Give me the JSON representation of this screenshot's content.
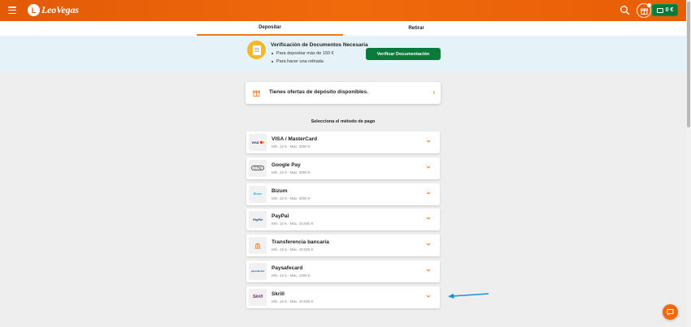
{
  "header": {
    "brand": "LeoVegas",
    "balance": "0 €",
    "icons": [
      "menu-icon",
      "search-icon",
      "gift-icon",
      "wallet-icon"
    ]
  },
  "tabs": [
    {
      "label": "Depositar",
      "active": true
    },
    {
      "label": "Retirar",
      "active": false
    }
  ],
  "verification": {
    "title": "Verificación de Documentos Necesaria",
    "items": [
      "Para depositar más de 150 €",
      "Para hacer una retirada"
    ],
    "button_label": "Verificar Documentación"
  },
  "offers": {
    "label": "Tienes ofertas de depósito disponibles."
  },
  "methods_heading": "Selecciona el método de pago",
  "methods": [
    {
      "name": "VISA / MasterCard",
      "limits": "Mín. 10 € - Máx. 3000 €",
      "logo_text": "VISA"
    },
    {
      "name": "Google Pay",
      "limits": "Mín. 10 € - Máx. 3000 €",
      "logo_text": "G Pay"
    },
    {
      "name": "Bizum",
      "limits": "Mín. 10 € - Máx. 3000 €",
      "logo_text": "Bizum"
    },
    {
      "name": "PayPal",
      "limits": "Mín. 10 € - Máx. 10.000 €",
      "logo_text": "PayPal"
    },
    {
      "name": "Transferencia bancaria",
      "limits": "Mín. 10 € - Máx. 10.000 €",
      "logo_text": ""
    },
    {
      "name": "Paysafecard",
      "limits": "Mín. 10 € - Máx. 1000 €",
      "logo_text": "paysafecard"
    },
    {
      "name": "Skrill",
      "limits": "Mín. 10 € - Máx. 10.000 €",
      "logo_text": "Skrill"
    }
  ],
  "colors": {
    "brand_orange": "#f06a0c",
    "action_green": "#0a7a3a",
    "banner_bg": "#e5f3f8",
    "annotation_blue": "#1e90d6"
  }
}
